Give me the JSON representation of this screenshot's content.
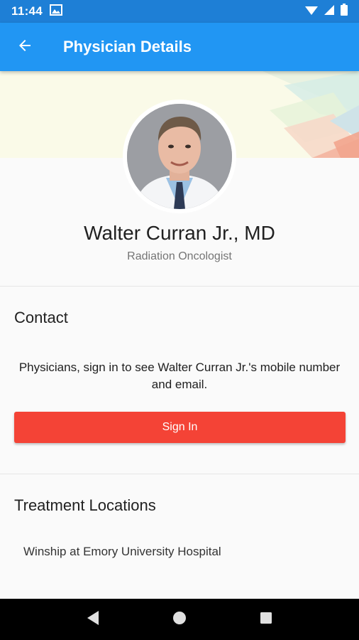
{
  "status_bar": {
    "time": "11:44",
    "icons": [
      "gallery-notification-icon",
      "wifi-icon",
      "signal-icon",
      "battery-icon"
    ]
  },
  "app_bar": {
    "back_icon": "arrow-back-icon",
    "title": "Physician Details",
    "color": "#2196f3"
  },
  "profile": {
    "name": "Walter Curran Jr., MD",
    "specialty": "Radiation Oncologist",
    "photo_icon": "physician-photo"
  },
  "contact": {
    "title": "Contact",
    "message": "Physicians, sign in to see Walter Curran Jr.'s mobile number and email.",
    "signin_label": "Sign In",
    "button_color": "#f44336"
  },
  "treatment": {
    "title": "Treatment Locations",
    "locations": [
      "Winship at Emory University Hospital"
    ]
  },
  "nav_bar": {
    "icons": [
      "back-triangle-icon",
      "home-circle-icon",
      "recents-square-icon"
    ]
  }
}
